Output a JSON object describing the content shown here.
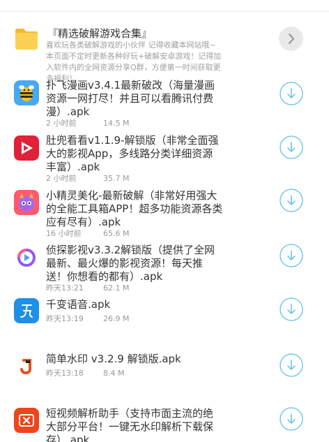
{
  "folder": {
    "title": "『精选破解游戏合集』",
    "description": "喜欢玩各类破解游戏的小伙伴 记得收藏本网站哦~本页面不定时更新各种好玩+破解安卓游戏！记得加入软件内的全网资源分享Q群，方便第一时间获取更多福利！",
    "icon": "folder-icon",
    "arrow_icon": "chevron-right-icon"
  },
  "files": [
    {
      "name": "扑飞漫画v3.4.1最新破改（海量漫画资源一网打尽！并且可以看腾讯付费漫）.apk",
      "time": "2 小时前",
      "size": "14.5 M",
      "icon": "bee-app-icon",
      "download_icon": "download-icon"
    },
    {
      "name": "肚兜看看v1.1.9-解锁版（非常全面强大的影视App，多线路分类详细资源丰富）.apk",
      "time": "2 小时前",
      "size": "35.7 M",
      "icon": "play-app-icon",
      "download_icon": "download-icon"
    },
    {
      "name": "小精灵美化-最新破解（非常好用强大的全能工具箱APP！超多功能资源各类应有尽有）.apk",
      "time": "16 小时前",
      "size": "65.6 M",
      "icon": "sprite-app-icon",
      "download_icon": "download-icon"
    },
    {
      "name": "侦探影视v3.3.2解锁版（提供了全网最新、最火爆的影视资源！每天推送！你想看的都有）.apk",
      "time": "昨天13:21",
      "size": "62.1 M",
      "icon": "detective-app-icon",
      "download_icon": "download-icon"
    },
    {
      "name": "千变语音.apk",
      "time": "昨天13:19",
      "size": "26.9 M",
      "icon": "voice-app-icon",
      "download_icon": "download-icon"
    },
    {
      "name": "简单水印 v3.2.9 解锁版.apk",
      "time": "昨天13:18",
      "size": "8.4 M",
      "icon": "watermark-app-icon",
      "download_icon": "download-icon"
    },
    {
      "name": "短视频解析助手（支持市面主流的绝大部分平台！一键无水印解析下载保存）.apk",
      "time": "",
      "size": "",
      "icon": "video-parser-app-icon",
      "download_icon": "download-icon"
    }
  ],
  "colors": {
    "accent": "#5ec0ec",
    "title": "#333333",
    "meta": "#999999",
    "divider": "#eeeeee"
  }
}
